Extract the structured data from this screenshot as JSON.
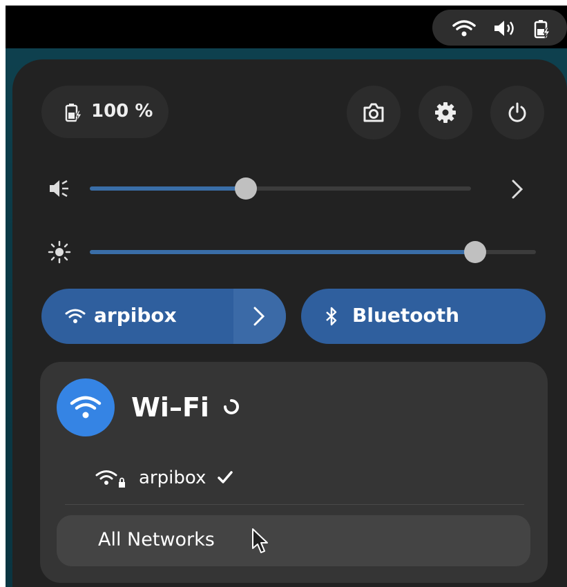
{
  "status_bar": {
    "icons": [
      "wifi-icon",
      "volume-icon",
      "battery-charging-icon"
    ]
  },
  "quick_settings": {
    "battery": {
      "label": "100 %",
      "icon": "battery-charging-icon"
    },
    "actions": [
      {
        "name": "screenshot",
        "icon": "camera-icon"
      },
      {
        "name": "settings",
        "icon": "gear-icon"
      },
      {
        "name": "power",
        "icon": "power-icon"
      }
    ],
    "volume": {
      "icon": "speaker-icon",
      "level": 0.41
    },
    "brightness": {
      "icon": "sun-icon",
      "level": 0.86
    },
    "wifi_toggle": {
      "label": "arpibox",
      "icon": "wifi-icon"
    },
    "bluetooth_toggle": {
      "label": "Bluetooth",
      "icon": "bluetooth-icon"
    },
    "accent_color": "#3584e4",
    "toggle_color": "#2f5f9e"
  },
  "wifi_menu": {
    "title": "Wi–Fi",
    "networks": [
      {
        "name": "arpibox",
        "connected": true,
        "secured": true
      }
    ],
    "all_networks_label": "All Networks"
  }
}
